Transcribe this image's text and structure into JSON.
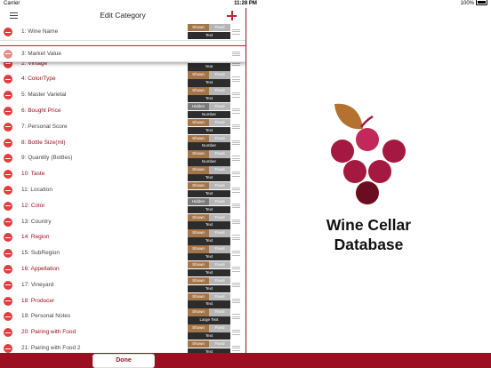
{
  "status_bar": {
    "carrier": "Carrier",
    "time": "11:28 PM",
    "battery": "100%"
  },
  "nav": {
    "title": "Edit Category"
  },
  "rows": [
    {
      "label": "1:  Wine Name",
      "label_color": "gray",
      "visibility": "Shown",
      "mode": "Fixed",
      "type": "Text"
    },
    {
      "label": "3:  Market Value",
      "label_color": "gray",
      "visibility": "",
      "mode": "",
      "type": "",
      "dragging": true
    },
    {
      "label": "2:  Vintage",
      "label_color": "red",
      "visibility": "",
      "mode": "",
      "type": "Year"
    },
    {
      "label": "4:  Color/Type",
      "label_color": "red",
      "visibility": "Shown",
      "mode": "Fixed",
      "type": "Text"
    },
    {
      "label": "5:  Master Varietal",
      "label_color": "gray",
      "visibility": "Shown",
      "mode": "Fixed",
      "type": "Text"
    },
    {
      "label": "6:  Bought Price",
      "label_color": "red",
      "visibility": "Hidden",
      "mode": "Fixed",
      "type": "Number"
    },
    {
      "label": "7:  Personal Score",
      "label_color": "gray",
      "visibility": "Shown",
      "mode": "Fixed",
      "type": "Text"
    },
    {
      "label": "8:  Bottle Size(ml)",
      "label_color": "red",
      "visibility": "Shown",
      "mode": "Fixed",
      "type": "Number"
    },
    {
      "label": "9:  Quantity (Bottles)",
      "label_color": "gray",
      "visibility": "Shown",
      "mode": "Fixed",
      "type": "Number"
    },
    {
      "label": "10:  Taste",
      "label_color": "red",
      "visibility": "Shown",
      "mode": "Fixed",
      "type": "Text"
    },
    {
      "label": "11:  Location",
      "label_color": "gray",
      "visibility": "Shown",
      "mode": "Fixed",
      "type": "Text"
    },
    {
      "label": "12:  Color",
      "label_color": "red",
      "visibility": "Hidden",
      "mode": "Fixed",
      "type": "Text"
    },
    {
      "label": "13:  Country",
      "label_color": "gray",
      "visibility": "Shown",
      "mode": "Fixed",
      "type": "Text"
    },
    {
      "label": "14:  Region",
      "label_color": "red",
      "visibility": "Shown",
      "mode": "Fixed",
      "type": "Text"
    },
    {
      "label": "15:  SubRegion",
      "label_color": "gray",
      "visibility": "Shown",
      "mode": "Fixed",
      "type": "Text"
    },
    {
      "label": "16:  Appellation",
      "label_color": "red",
      "visibility": "Shown",
      "mode": "Fixed",
      "type": "Text"
    },
    {
      "label": "17:  Vineyard",
      "label_color": "gray",
      "visibility": "Shown",
      "mode": "Fixed",
      "type": "Text"
    },
    {
      "label": "18:  Producer",
      "label_color": "red",
      "visibility": "Shown",
      "mode": "Fixed",
      "type": "Text"
    },
    {
      "label": "19:  Personal Notes",
      "label_color": "gray",
      "visibility": "Shown",
      "mode": "Fixed",
      "type": "Large Text"
    },
    {
      "label": "20:  Pairing with Food",
      "label_color": "red",
      "visibility": "Shown",
      "mode": "Fixed",
      "type": "Text"
    },
    {
      "label": "21:  Pairing with Food 2",
      "label_color": "gray",
      "visibility": "Shown",
      "mode": "Fixed",
      "type": "Text"
    }
  ],
  "footer": {
    "done_label": "Done"
  },
  "brand": {
    "line1": "Wine Cellar",
    "line2": "Database"
  },
  "colors": {
    "accent": "#9b1020",
    "delete": "#e33d3d",
    "shown": "#a5754a",
    "hidden": "#7a7a7a",
    "fixed": "#b5b5b5",
    "type_bg": "#2c2c2c",
    "leaf": "#b5712f",
    "grape_light": "#c2285a",
    "grape_mid": "#a5183f",
    "grape_dark": "#6b0d20"
  }
}
